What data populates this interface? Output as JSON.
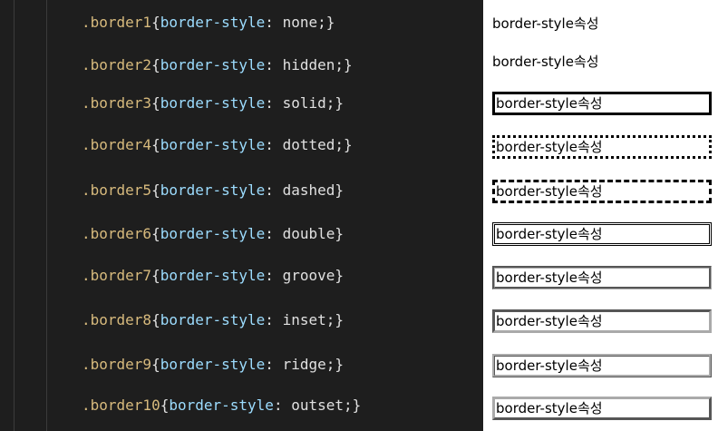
{
  "code": [
    {
      "selector": ".border1",
      "property": "border-style",
      "value": " none;"
    },
    {
      "selector": ".border2",
      "property": "border-style",
      "value": " hidden;"
    },
    {
      "selector": ".border3",
      "property": "border-style",
      "value": " solid;"
    },
    {
      "selector": ".border4",
      "property": "border-style",
      "value": " dotted;"
    },
    {
      "selector": ".border5",
      "property": "border-style",
      "value": " dashed"
    },
    {
      "selector": ".border6",
      "property": "border-style",
      "value": " double"
    },
    {
      "selector": ".border7",
      "property": "border-style",
      "value": " groove"
    },
    {
      "selector": ".border8",
      "property": "border-style",
      "value": " inset;"
    },
    {
      "selector": ".border9",
      "property": "border-style",
      "value": " ridge;"
    },
    {
      "selector": ".border10",
      "property": "border-style",
      "value": " outset;"
    }
  ],
  "preview": [
    {
      "text": "border-style속성",
      "style": "none"
    },
    {
      "text": "border-style속성",
      "style": "hidden"
    },
    {
      "text": "border-style속성",
      "style": "solid"
    },
    {
      "text": "border-style속성",
      "style": "dotted"
    },
    {
      "text": "border-style속성",
      "style": "dashed"
    },
    {
      "text": "border-style속성",
      "style": "double"
    },
    {
      "text": "border-style속성",
      "style": "groove"
    },
    {
      "text": "border-style속성",
      "style": "inset"
    },
    {
      "text": "border-style속성",
      "style": "ridge"
    },
    {
      "text": "border-style속성",
      "style": "outset"
    }
  ],
  "colors": {
    "editor_background": "#1e1e1e",
    "selector": "#d7ba7d",
    "property": "#9cdcfe",
    "text": "#e0e0e0",
    "preview_background": "#ffffff"
  }
}
